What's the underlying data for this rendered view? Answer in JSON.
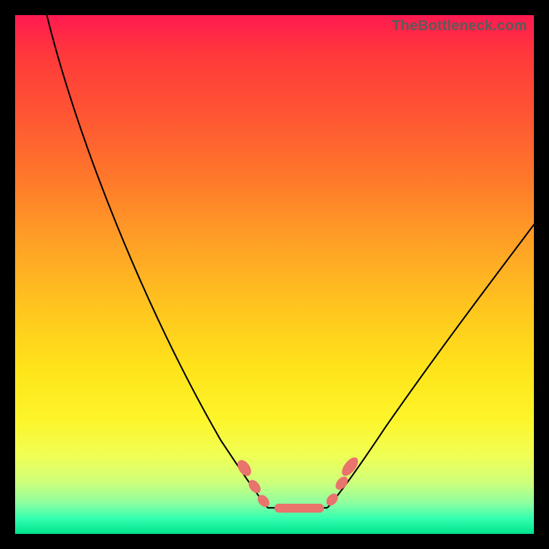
{
  "watermark": "TheBottleneck.com",
  "chart_data": {
    "type": "line",
    "title": "",
    "xlabel": "",
    "ylabel": "",
    "xlim": [
      0,
      100
    ],
    "ylim": [
      0,
      100
    ],
    "grid": false,
    "legend": false,
    "series": [
      {
        "name": "left-curve",
        "x": [
          6,
          10,
          15,
          20,
          25,
          30,
          35,
          40,
          45,
          48
        ],
        "y": [
          100,
          89,
          77,
          65,
          54,
          43,
          32,
          21,
          11,
          5
        ]
      },
      {
        "name": "flat-minimum",
        "x": [
          48,
          52,
          56,
          60
        ],
        "y": [
          5,
          4,
          4,
          5
        ]
      },
      {
        "name": "right-curve",
        "x": [
          60,
          65,
          70,
          75,
          80,
          85,
          90,
          95,
          100
        ],
        "y": [
          5,
          10,
          17,
          25,
          33,
          41,
          49,
          56,
          62
        ]
      }
    ],
    "markers": [
      {
        "name": "bead-left-upper",
        "x": 44,
        "y": 13
      },
      {
        "name": "bead-left-mid",
        "x": 46,
        "y": 9
      },
      {
        "name": "bead-left-lower",
        "x": 48,
        "y": 6
      },
      {
        "name": "bead-flat-1",
        "x": 51,
        "y": 4
      },
      {
        "name": "bead-flat-2",
        "x": 54,
        "y": 4
      },
      {
        "name": "bead-flat-3",
        "x": 57,
        "y": 4
      },
      {
        "name": "bead-right-lower",
        "x": 61,
        "y": 6
      },
      {
        "name": "bead-right-mid",
        "x": 63,
        "y": 10
      },
      {
        "name": "bead-right-upper",
        "x": 64,
        "y": 13
      }
    ]
  }
}
